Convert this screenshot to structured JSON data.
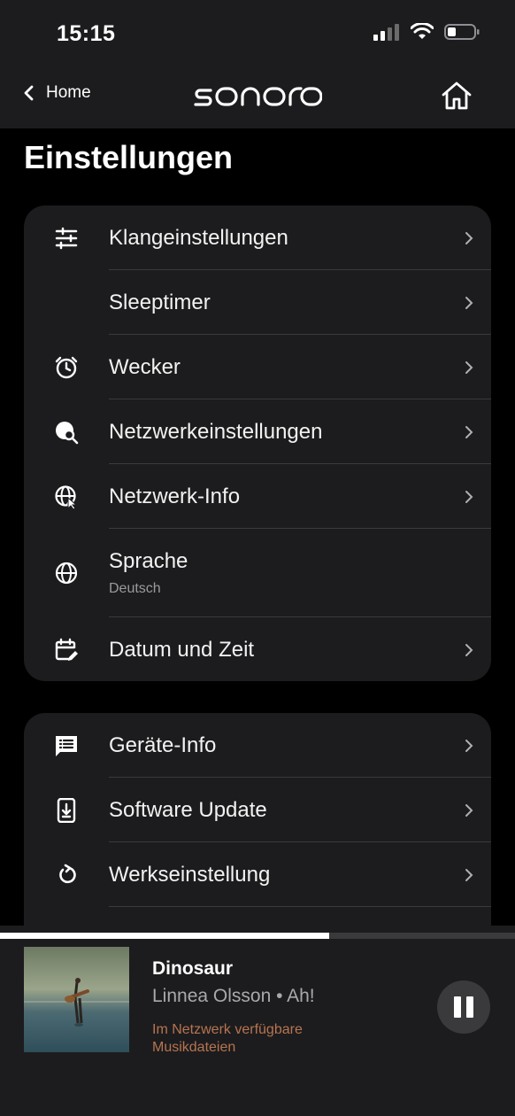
{
  "status": {
    "time": "15:15"
  },
  "nav": {
    "back_label": "Home",
    "logo_text": "sonoro"
  },
  "page": {
    "title": "Einstellungen"
  },
  "settings_group1": [
    {
      "label": "Klangeinstellungen",
      "icon": "sliders-icon"
    },
    {
      "label": "Sleeptimer",
      "icon": "moon-icon"
    },
    {
      "label": "Wecker",
      "icon": "alarm-clock-icon"
    },
    {
      "label": "Netzwerkeinstellungen",
      "icon": "network-search-icon"
    },
    {
      "label": "Netzwerk-Info",
      "icon": "network-info-icon"
    },
    {
      "label": "Sprache",
      "sub": "Deutsch",
      "icon": "globe-icon"
    },
    {
      "label": "Datum und Zeit",
      "icon": "calendar-edit-icon"
    }
  ],
  "settings_group2": [
    {
      "label": "Geräte-Info",
      "icon": "device-info-icon"
    },
    {
      "label": "Software Update",
      "icon": "download-icon"
    },
    {
      "label": "Werkseinstellung",
      "icon": "reset-icon"
    }
  ],
  "player": {
    "title": "Dinosaur",
    "subtitle": "Linnea Olsson • Ah!",
    "source": "Im Netzwerk verfügbare Musikdateien",
    "progress_fraction": 0.64,
    "colors": {
      "source_text": "#b77450"
    }
  }
}
